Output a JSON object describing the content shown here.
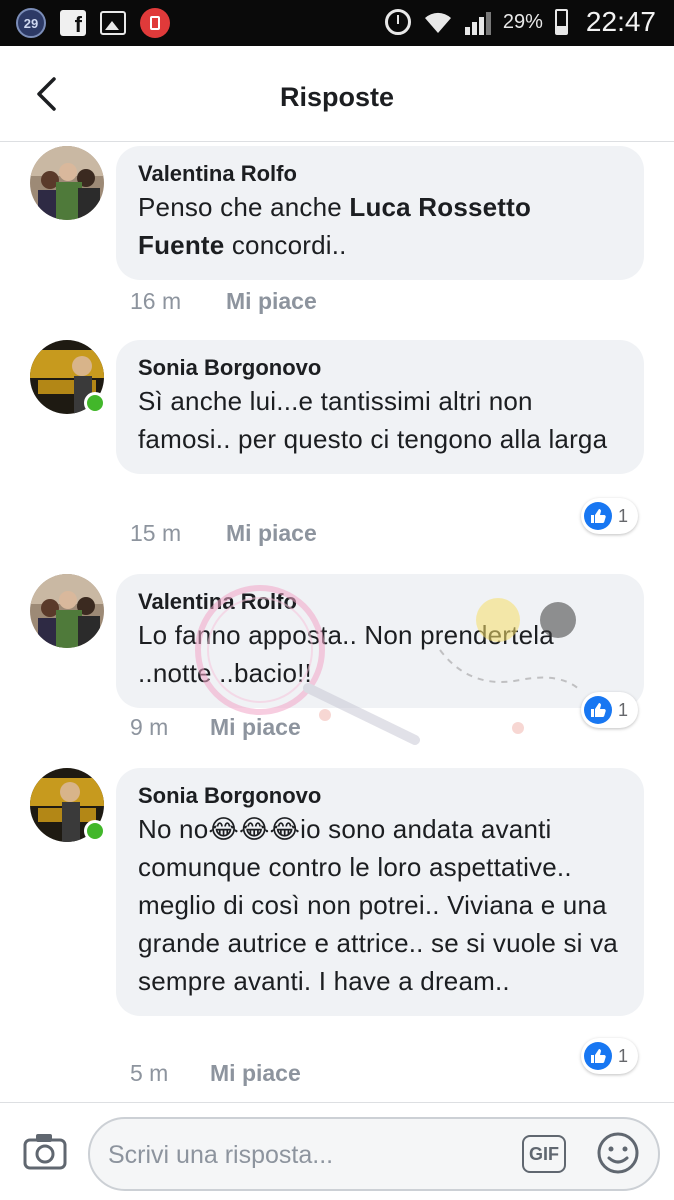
{
  "status_bar": {
    "notification_count": "29",
    "battery_percent": "29%",
    "time": "22:47",
    "icons": [
      "notification-badge-icon",
      "facebook-icon",
      "gallery-icon",
      "recorder-icon",
      "alarm-icon",
      "wifi-icon",
      "signal-icon",
      "battery-icon"
    ]
  },
  "header": {
    "title": "Risposte",
    "back_icon": "chevron-left-icon"
  },
  "comments": [
    {
      "author": "Valentina Rolfo",
      "text_parts": [
        {
          "t": "Penso che anche ",
          "bold": false
        },
        {
          "t": "Luca Rossetto",
          "bold": true
        },
        {
          "t": " ",
          "bold": false
        },
        {
          "t": "Fuente",
          "bold": true
        },
        {
          "t": " concordi..",
          "bold": false
        }
      ],
      "time": "16 m",
      "like_label": "Mi piace",
      "online": false,
      "reactions": null
    },
    {
      "author": "Sonia Borgonovo",
      "text": "Sì anche lui...e tantissimi altri non famosi.. per questo ci tengono alla larga",
      "time": "15 m",
      "like_label": "Mi piace",
      "online": true,
      "reactions": "1"
    },
    {
      "author": "Valentina Rolfo",
      "text": "Lo fanno apposta.. Non prendertela ..notte ..bacio!!",
      "time": "9 m",
      "like_label": "Mi piace",
      "online": false,
      "reactions": "1"
    },
    {
      "author": "Sonia Borgonovo",
      "text": "No no😂😂😂io sono andata avanti comunque contro le loro aspettative.. meglio di così non potrei.. Viviana e una grande autrice e attrice.. se si vuole si va sempre avanti. I have a dream..",
      "time": "5 m",
      "like_label": "Mi piace",
      "online": true,
      "reactions": "1"
    }
  ],
  "composer": {
    "placeholder": "Scrivi una risposta...",
    "gif_label": "GIF",
    "camera_icon": "camera-icon",
    "emoji_icon": "emoji-icon"
  },
  "colors": {
    "bubble": "#f0f2f5",
    "like_blue": "#1877f2",
    "online_green": "#42b72a",
    "meta_gray": "#8d949e"
  }
}
